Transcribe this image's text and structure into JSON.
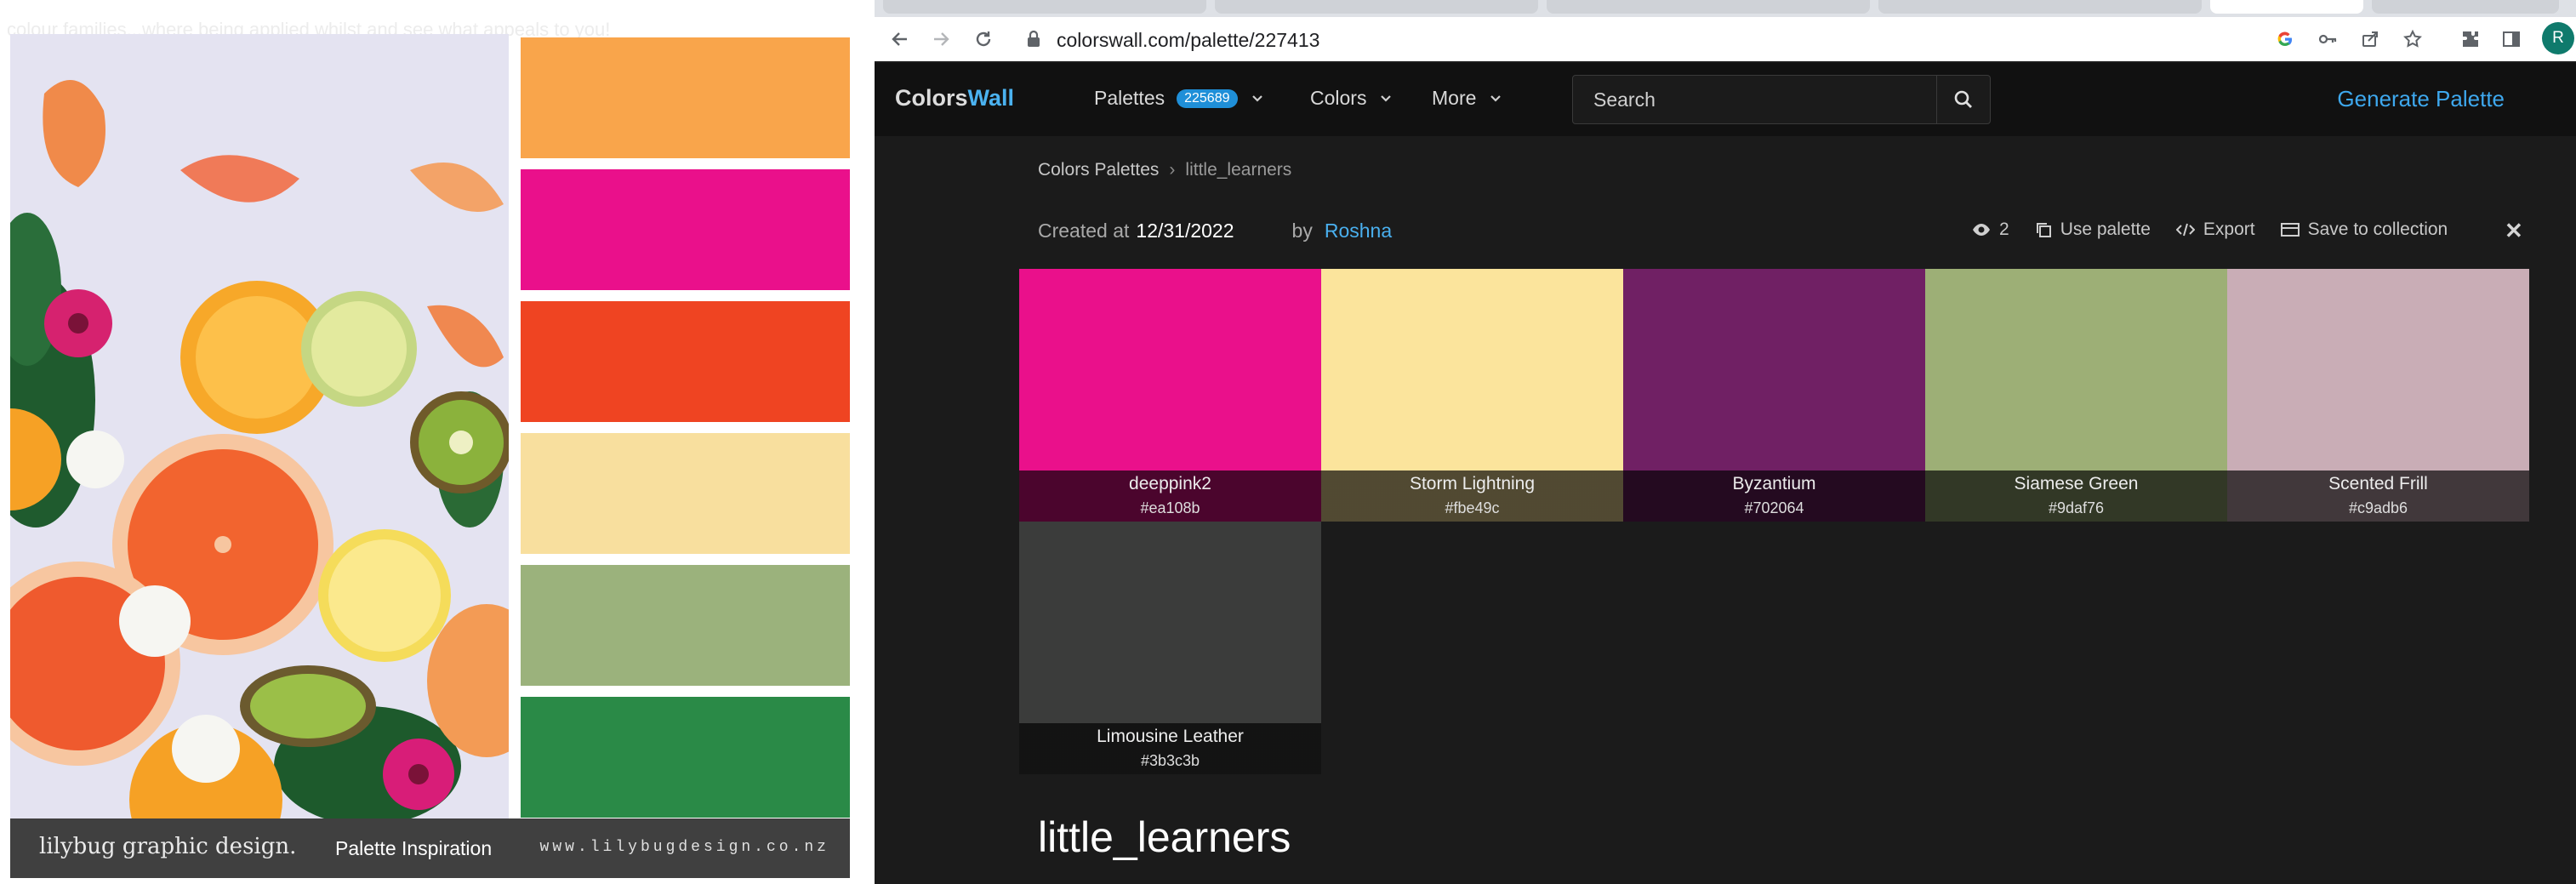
{
  "left_panel": {
    "faint_text": "colour families...where being applied whilst and see what appeals to you!",
    "swatch_colors": [
      "#f9a54b",
      "#ea108b",
      "#ef4422",
      "#f8df9e",
      "#9bb27c",
      "#2a8a47"
    ],
    "footer": {
      "brand": "lilybug graphic design.",
      "caption": "Palette Inspiration",
      "url": "www.lilybugdesign.co.nz"
    }
  },
  "browser": {
    "url": "colorswall.com/palette/227413",
    "profile_initial": "R"
  },
  "site": {
    "logo_part1": "Colors",
    "logo_part2": "Wall",
    "nav": {
      "palettes_label": "Palettes",
      "palettes_count": "225689",
      "colors_label": "Colors",
      "more_label": "More"
    },
    "search_placeholder": "Search",
    "generate_label": "Generate Palette"
  },
  "page": {
    "breadcrumb": {
      "root": "Colors Palettes",
      "current": "little_learners"
    },
    "meta": {
      "created_label": "Created at",
      "created_date": "12/31/2022",
      "by_label": "by",
      "author": "Roshna"
    },
    "actions": {
      "views": "2",
      "use_palette": "Use palette",
      "export": "Export",
      "save_to_collection": "Save to collection"
    },
    "colors": [
      {
        "name": "deeppink2",
        "hex": "#ea108b"
      },
      {
        "name": "Storm Lightning",
        "hex": "#fbe49c"
      },
      {
        "name": "Byzantium",
        "hex": "#702064"
      },
      {
        "name": "Siamese Green",
        "hex": "#9daf76"
      },
      {
        "name": "Scented Frill",
        "hex": "#c9adb6"
      },
      {
        "name": "Limousine Leather",
        "hex": "#3b3c3b"
      }
    ],
    "title": "little_learners"
  }
}
